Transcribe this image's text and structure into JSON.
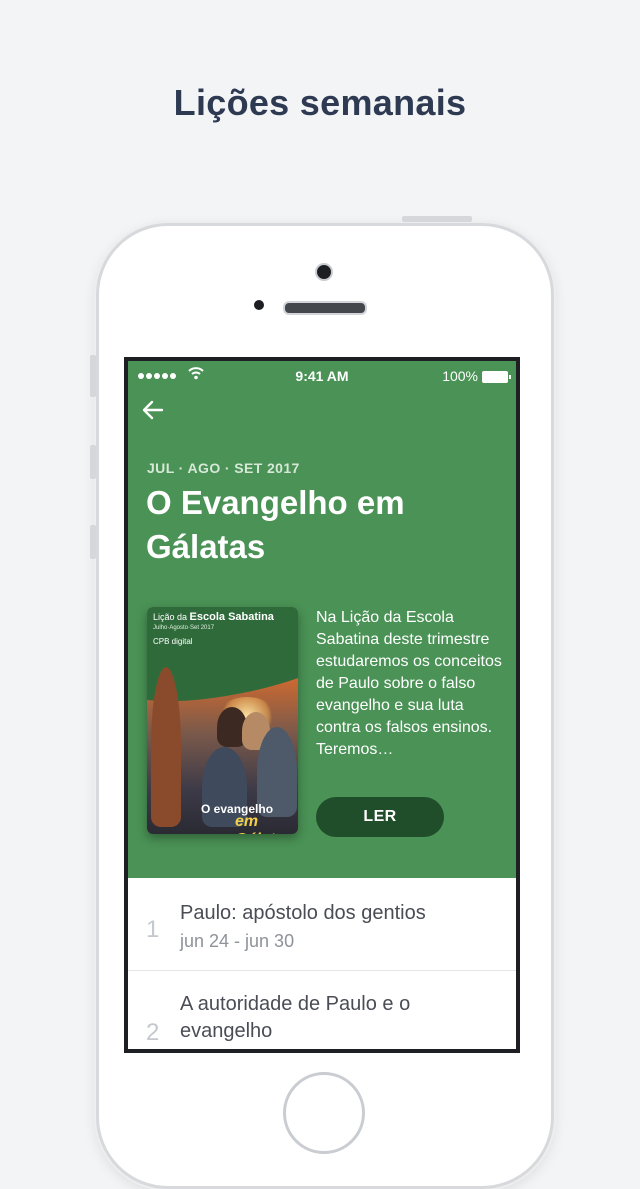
{
  "headline": "Lições semanais",
  "status_bar": {
    "time": "9:41 AM",
    "battery": "100%"
  },
  "lesson": {
    "quarter": "JUL · AGO · SET 2017",
    "title": "O Evangelho em Gálatas",
    "description": "Na Lição da Escola Sabatina deste trimestre estudaremos os conceitos de Paulo sobre o falso evangelho e sua luta contra os falsos ensinos. Teremos…",
    "read_button": "LER",
    "cover": {
      "series_prefix": "Lição da",
      "series_name": "Escola Sabatina",
      "date": "Julho·Agosto·Set 2017",
      "brand": "CPB digital",
      "title_line1": "O evangelho",
      "title_line2": "em Gálatas"
    }
  },
  "lessons_list": [
    {
      "number": "1",
      "title": "Paulo: apóstolo dos gentios",
      "dates": "jun 24 - jun 30"
    },
    {
      "number": "2",
      "title": "A autoridade de Paulo e o evangelho",
      "dates": ""
    }
  ],
  "colors": {
    "hero": "#4a9255",
    "button": "#204d2a",
    "headline": "#2e3a52"
  },
  "icons": {
    "back": "arrow-left-icon",
    "wifi": "wifi-icon",
    "battery": "battery-icon",
    "signal": "signal-dots-icon"
  }
}
